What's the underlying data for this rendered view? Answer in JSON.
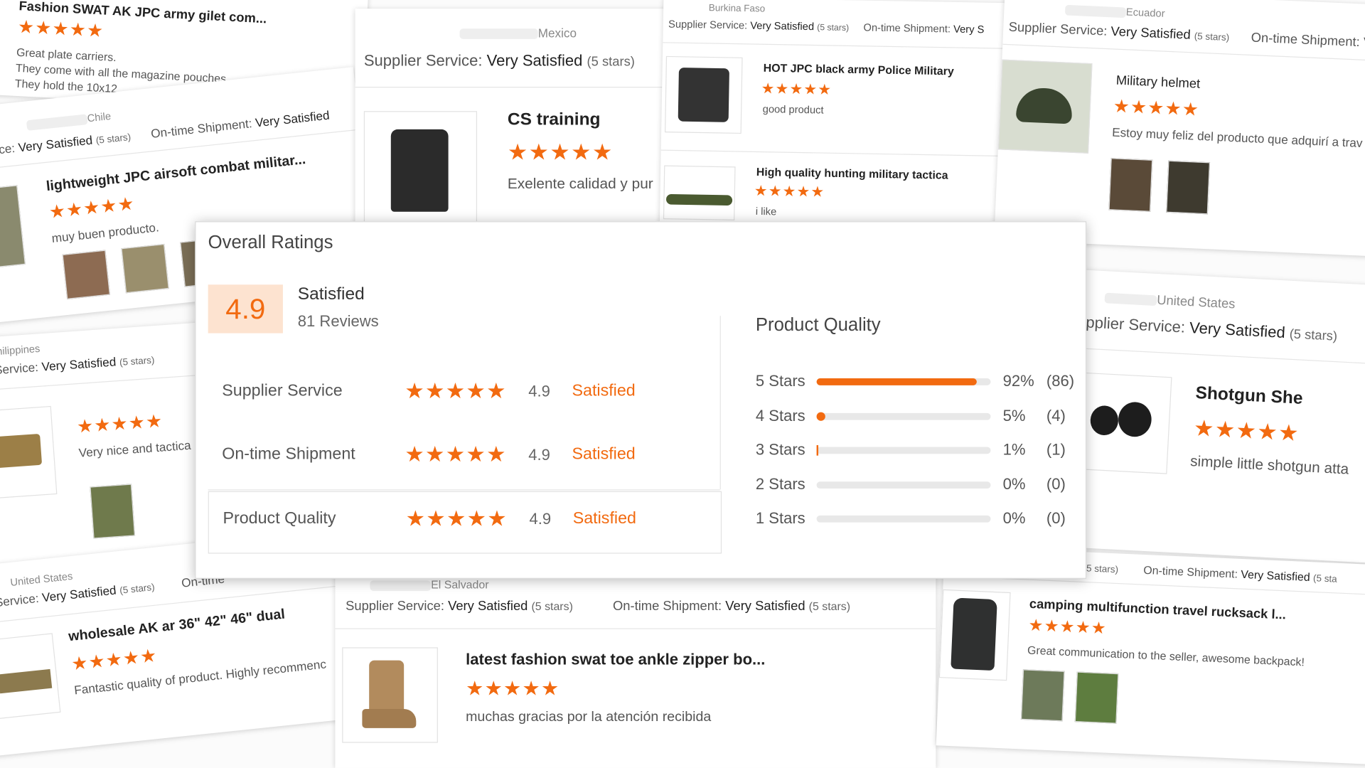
{
  "overall": {
    "title": "Overall Ratings",
    "score": "4.9",
    "label": "Satisfied",
    "reviews": "81 Reviews",
    "rows": [
      {
        "label": "Supplier Service",
        "stars": "★★★★★",
        "value": "4.9",
        "text": "Satisfied"
      },
      {
        "label": "On-time Shipment",
        "stars": "★★★★★",
        "value": "4.9",
        "text": "Satisfied"
      },
      {
        "label": "Product Quality",
        "stars": "★★★★★",
        "value": "4.9",
        "text": "Satisfied"
      }
    ],
    "quality": {
      "title": "Product Quality",
      "bars": [
        {
          "label": "5 Stars",
          "fraction": 0.92,
          "pct": "92%",
          "count": "(86)"
        },
        {
          "label": "4 Stars",
          "fraction": 0.05,
          "pct": "5%",
          "count": "(4)"
        },
        {
          "label": "3 Stars",
          "fraction": 0.01,
          "pct": "1%",
          "count": "(1)"
        },
        {
          "label": "2 Stars",
          "fraction": 0.0,
          "pct": "0%",
          "count": "(0)"
        },
        {
          "label": "1 Stars",
          "fraction": 0.0,
          "pct": "0%",
          "count": "(0)"
        }
      ]
    }
  },
  "colors": {
    "accent": "#f26a10",
    "accent_light": "#fde3d0"
  },
  "stars": "★★★★★",
  "common": {
    "supplier_service": "Supplier Service:",
    "very_satisfied": "Very Satisfied",
    "five_stars": "(5 stars)",
    "ontime": "On-time Shipment:",
    "service_cut": "Service:",
    "vice_cut": "vice:",
    "pplier_cut": "pplier Service:",
    "ontime_cut": "On-time",
    "very_s": "Very S",
    "stars_cut": "(5 sta",
    "ontime_trunc": "On-time Shipment: V"
  },
  "cards": {
    "c1": {
      "title": "Fashion SWAT AK JPC army gilet com...",
      "review1": "Great plate carriers.",
      "review2": "They come with all the magazine pouches",
      "review3": "They hold the 10x12"
    },
    "c2": {
      "country": "Chile",
      "title": "lightweight JPC airsoft combat militar...",
      "review": "muy buen producto."
    },
    "c3": {
      "country": "Mexico",
      "title": "CS training",
      "review": "Exelente calidad y pur"
    },
    "c4": {
      "country": "Burkina Faso",
      "title1": "HOT JPC black army Police Military",
      "review1": "good product",
      "title2": "High quality hunting military tactica",
      "review2": "i like"
    },
    "c5": {
      "country": "Ecuador",
      "title": "Military helmet",
      "review": "Estoy muy feliz del producto que adquirí a trav"
    },
    "c6": {
      "country": "Philippines",
      "review": "Very nice and tactica"
    },
    "c7": {
      "country": "United States",
      "title": "Shotgun She",
      "review": "simple little shotgun atta"
    },
    "c8": {
      "country": "United States",
      "title": "wholesale AK ar 36\" 42\" 46\" dual",
      "review": "Fantastic quality of product. Highly recommenc"
    },
    "c9": {
      "country": "El Salvador",
      "title": "latest fashion swat toe ankle zipper bo...",
      "review": "muchas gracias por la atención recibida"
    },
    "c10": {
      "title": "camping multifunction travel rucksack l...",
      "review": "Great communication to the seller, awesome backpack!"
    }
  }
}
